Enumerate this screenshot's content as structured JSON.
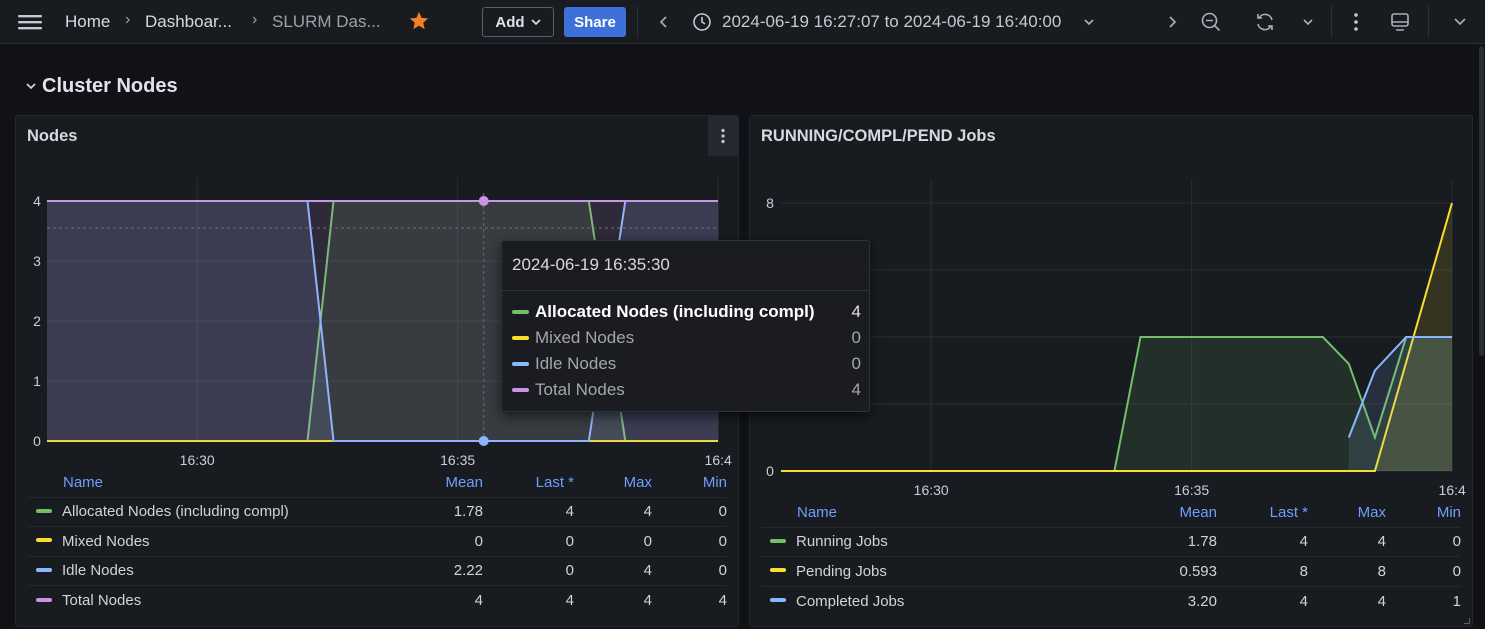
{
  "topbar": {
    "breadcrumb": [
      "Home",
      "Dashboar...",
      "SLURM Das..."
    ],
    "add_label": "Add",
    "share_label": "Share",
    "time_range": "2024-06-19 16:27:07 to 2024-06-19 16:40:00",
    "icons": [
      "menu-icon",
      "star-icon",
      "chevron-left-icon",
      "clock-icon",
      "chevron-right-icon",
      "zoom-out-icon",
      "refresh-icon",
      "kiosk-icon",
      "more-icon"
    ],
    "accent": "#3d71d9",
    "star_color": "#f47e23"
  },
  "section": {
    "title": "Cluster Nodes"
  },
  "panels": {
    "nodes": {
      "title": "Nodes",
      "legend": {
        "headers": [
          "Name",
          "Mean",
          "Last *",
          "Max",
          "Min"
        ],
        "rows": [
          {
            "name": "Allocated Nodes (including compl)",
            "mean": "1.78",
            "last": "4",
            "max": "4",
            "min": "0",
            "color": "#73bf69"
          },
          {
            "name": "Mixed Nodes",
            "mean": "0",
            "last": "0",
            "max": "0",
            "min": "0",
            "color": "#fade2a"
          },
          {
            "name": "Idle Nodes",
            "mean": "2.22",
            "last": "0",
            "max": "4",
            "min": "0",
            "color": "#8ab8ff"
          },
          {
            "name": "Total Nodes",
            "mean": "4",
            "last": "4",
            "max": "4",
            "min": "4",
            "color": "#ca95e5"
          }
        ]
      }
    },
    "jobs": {
      "title": "RUNNING/COMPL/PEND Jobs",
      "legend": {
        "headers": [
          "Name",
          "Mean",
          "Last *",
          "Max",
          "Min"
        ],
        "rows": [
          {
            "name": "Running Jobs",
            "mean": "1.78",
            "last": "4",
            "max": "4",
            "min": "0",
            "color": "#73bf69"
          },
          {
            "name": "Pending Jobs",
            "mean": "0.593",
            "last": "8",
            "max": "8",
            "min": "0",
            "color": "#fade2a"
          },
          {
            "name": "Completed Jobs",
            "mean": "3.20",
            "last": "4",
            "max": "4",
            "min": "1",
            "color": "#8ab8ff"
          }
        ]
      }
    }
  },
  "tooltip": {
    "time": "2024-06-19 16:35:30",
    "rows": [
      {
        "label": "Allocated Nodes (including compl)",
        "value": "4",
        "color": "#73bf69"
      },
      {
        "label": "Mixed Nodes",
        "value": "0",
        "color": "#fade2a"
      },
      {
        "label": "Idle Nodes",
        "value": "0",
        "color": "#8ab8ff"
      },
      {
        "label": "Total Nodes",
        "value": "4",
        "color": "#ca95e5"
      }
    ]
  },
  "chart_data": [
    {
      "type": "area",
      "title": "Nodes",
      "x_ticks": [
        "16:30",
        "16:35",
        "16:4"
      ],
      "y_ticks": [
        "0",
        "1",
        "2",
        "3",
        "4"
      ],
      "ylim": [
        0,
        4
      ],
      "x_unit": "minutes after 16:27:07",
      "xlim": [
        0,
        12.88
      ],
      "series": [
        {
          "name": "Allocated Nodes (including compl)",
          "color": "#73bf69",
          "x": [
            0,
            5.0,
            5.5,
            10.4,
            11.1,
            12.88
          ],
          "values": [
            0,
            0,
            4,
            4,
            0,
            0
          ]
        },
        {
          "name": "Mixed Nodes",
          "color": "#fade2a",
          "x": [
            0,
            12.88
          ],
          "values": [
            0,
            0
          ]
        },
        {
          "name": "Idle Nodes",
          "color": "#8ab8ff",
          "x": [
            0,
            5.0,
            5.5,
            10.4,
            11.1,
            12.88
          ],
          "values": [
            4,
            4,
            0,
            0,
            4,
            4
          ]
        },
        {
          "name": "Total Nodes",
          "color": "#ca95e5",
          "x": [
            0,
            12.88
          ],
          "values": [
            4,
            4
          ]
        }
      ]
    },
    {
      "type": "area",
      "title": "RUNNING/COMPL/PEND Jobs",
      "x_ticks": [
        "16:30",
        "16:35",
        "16:4"
      ],
      "y_ticks": [
        "0",
        "8"
      ],
      "ylim": [
        0,
        8
      ],
      "x_unit": "minutes after 16:27:07",
      "xlim": [
        0,
        12.88
      ],
      "series": [
        {
          "name": "Running Jobs",
          "color": "#73bf69",
          "x": [
            0,
            6.4,
            6.9,
            10.4,
            10.9,
            11.4,
            12.0,
            12.88
          ],
          "values": [
            0,
            0,
            4,
            4,
            3.2,
            1.0,
            4,
            4
          ]
        },
        {
          "name": "Pending Jobs",
          "color": "#fade2a",
          "x": [
            0,
            11.4,
            12.88
          ],
          "values": [
            0,
            0,
            8
          ]
        },
        {
          "name": "Completed Jobs",
          "color": "#8ab8ff",
          "x": [
            10.9,
            11.4,
            12.0,
            12.88
          ],
          "values": [
            1,
            3.0,
            4,
            4
          ]
        }
      ]
    }
  ]
}
